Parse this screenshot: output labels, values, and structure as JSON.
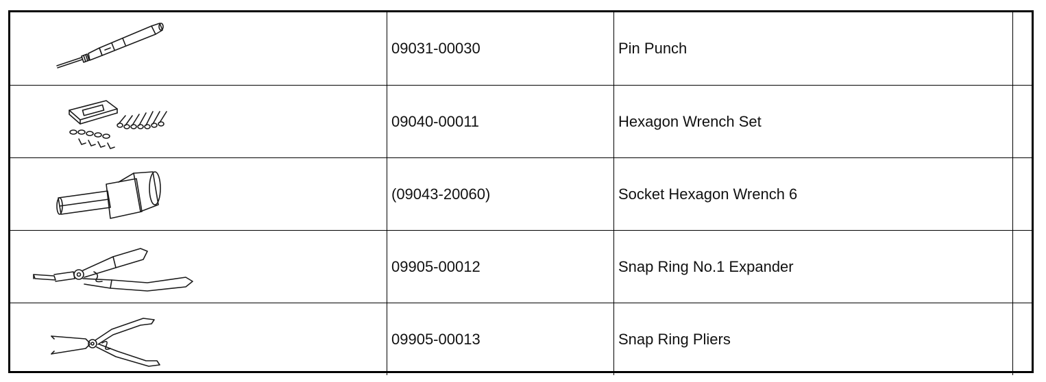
{
  "tools": [
    {
      "icon": "pin-punch-icon",
      "part_number": "09031-00030",
      "name": "Pin Punch",
      "note": ""
    },
    {
      "icon": "hexagon-wrench-set-icon",
      "part_number": "09040-00011",
      "name": "Hexagon Wrench Set",
      "note": ""
    },
    {
      "icon": "socket-hexagon-wrench-icon",
      "part_number": "(09043-20060)",
      "name": "Socket Hexagon Wrench 6",
      "note": ""
    },
    {
      "icon": "snap-ring-expander-icon",
      "part_number": "09905-00012",
      "name": "Snap Ring No.1 Expander",
      "note": ""
    },
    {
      "icon": "snap-ring-pliers-icon",
      "part_number": "09905-00013",
      "name": "Snap Ring Pliers",
      "note": ""
    }
  ]
}
